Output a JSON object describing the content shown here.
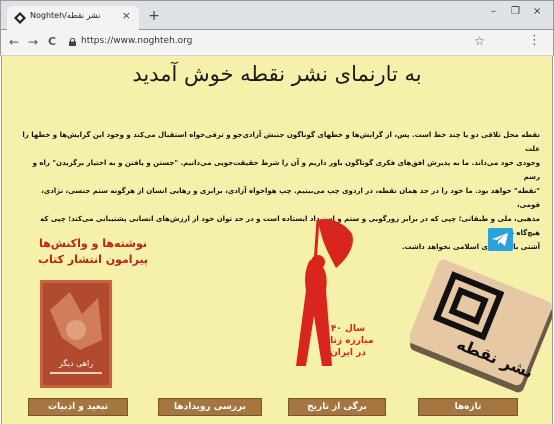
{
  "browser": {
    "tab_title": "Noghteh/نشر نقطه",
    "tab_close": "×",
    "new_tab": "+",
    "url": "https://www.noghteh.org",
    "window_controls": [
      "–",
      "❐",
      "×"
    ],
    "nav": {
      "back": "←",
      "forward": "→",
      "reload": "C"
    },
    "bookmark_icon": "☆",
    "menu_icon": "⋮"
  },
  "page": {
    "background": "#f6f1aa",
    "headline": "به تارنمای نشر نقطه خوش آمدید",
    "intro_lines": [
      "نقطه محل تلاقی دو یا چند خط است. پس، از گرایش‌ها و خطهای گوناگون جنبش آزادی‌جو و ترقی‌خواه استقبال می‌کند و وجود این گرایش‌ها و خطها را علت",
      "وجودی خود می‌داند. ما به پذیرش افق‌های فکری گوناگون باور داریم و آن را شرط حقیقت‌جویی می‌دانیم. \"جستن و یافتن و به اختیار برگزیدن\" راه و رسم",
      "\"نقطه\" خواهد بود. ما خود را در حد همان نقطه، در اردوی چپ می‌بینیم. چپ هواخواه آزادی، برابری و رهایی انسان از هرگونه ستم جنسی، نژادی، قومی،",
      "مذهبی، ملی و طبقاتی؛ چپی که در برابر زورگویی و ستم و استبداد ایستاده است و در حد توان خود از ارزش‌های انسانی پشتیبانی می‌کند؛ چپی که هیچ‌گاه سر",
      "آشتی با جمهوری اسلامی نخواهد داشت."
    ],
    "book_heading": "نوشته‌ها و واکنش‌ها پیرامون انتشار کتاب",
    "book_cover_text": "راهی دیگر",
    "poster_text": [
      "۴۰ سال",
      "مبارزه زنان",
      "در ایران"
    ],
    "logo_text": "نشر نقطه",
    "accent_red": "#d8261e",
    "button_color": "#a5763f",
    "nav_buttons": [
      {
        "label": "تبعید و ادبیات"
      },
      {
        "label": "بررسی رویدادها"
      },
      {
        "label": "برگی از تاریخ"
      },
      {
        "label": "تازه‌ها"
      }
    ]
  }
}
